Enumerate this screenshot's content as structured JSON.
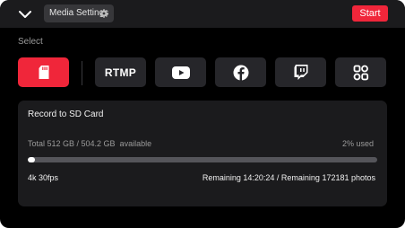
{
  "topbar": {
    "collapse_icon": "chevron-down-icon",
    "media_settings_label": "Media Settings",
    "media_settings_icon": "gear-icon",
    "start_label": "Start",
    "start_color": "#f0263a"
  },
  "select_label": "Select",
  "destinations": [
    {
      "id": "sd-card",
      "icon": "sd-card-icon",
      "active": true
    },
    {
      "id": "rtmp",
      "label": "RTMP",
      "active": false
    },
    {
      "id": "youtube",
      "icon": "youtube-icon",
      "active": false
    },
    {
      "id": "facebook",
      "icon": "facebook-icon",
      "active": false
    },
    {
      "id": "twitch",
      "icon": "twitch-icon",
      "active": false
    },
    {
      "id": "more",
      "icon": "multi-platform-icon",
      "active": false
    }
  ],
  "panel": {
    "title": "Record to SD Card",
    "storage_text": "Total 512 GB / 504.2 GB  available",
    "used_text": "2% used",
    "used_fraction": 0.02,
    "resolution_text": "4k 30fps",
    "remaining_text": "Remaining 14:20:24 / Remaining 172181 photos"
  }
}
